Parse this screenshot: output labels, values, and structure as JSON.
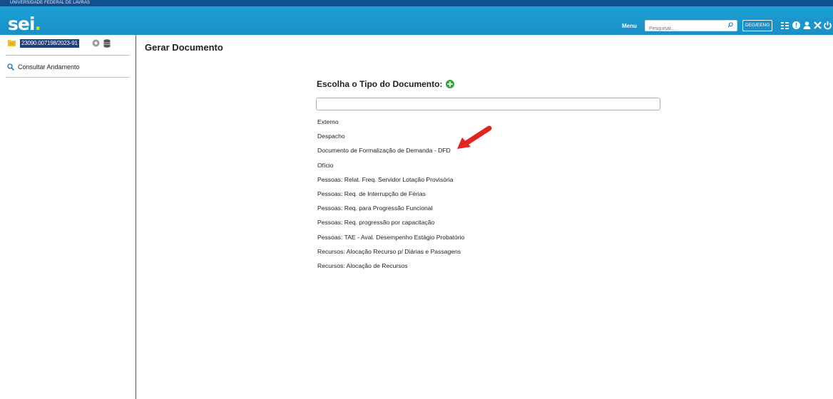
{
  "header": {
    "university": "UNIVERSIDADE FEDERAL DE LAVRAS",
    "logo": "sei",
    "logo_dot": ".",
    "menu_label": "Menu",
    "search_placeholder": "Pesquisar...",
    "unit_badge": "DEG/EENG",
    "icons": [
      "search-icon",
      "grid-list-icon",
      "info-icon",
      "user-icon",
      "close-x-icon",
      "power-icon"
    ]
  },
  "sidebar": {
    "process_number": "23090.007198/2023-91",
    "consultar_label": "Consultar Andamento",
    "icons": [
      "folder-icon",
      "gear-icon",
      "database-icon",
      "search-icon"
    ]
  },
  "main": {
    "page_title": "Gerar Documento",
    "choose_title": "Escolha o Tipo do Documento:",
    "document_types": [
      "Externo",
      "Despacho",
      "Documento de Formalização de Demanda - DFD",
      "Ofício",
      "Pessoas: Relat. Freq. Servidor Lotação Provisória",
      "Pessoas: Req. de Interrupção de Férias",
      "Pessoas: Req. para Progressão Funcional",
      "Pessoas: Req. progressão por capacitação",
      "Pessoas: TAE - Aval. Desempenho Estágio Probatório",
      "Recursos: Alocação Recurso p/ Diárias e Passagens",
      "Recursos: Alocação de Recursos"
    ]
  },
  "colors": {
    "header_blue": "#1a9bd0",
    "univ_bar": "#124f8f",
    "process_badge": "#1f3f78",
    "plus_green": "#2fa83c",
    "arrow_red": "#e3251f"
  }
}
